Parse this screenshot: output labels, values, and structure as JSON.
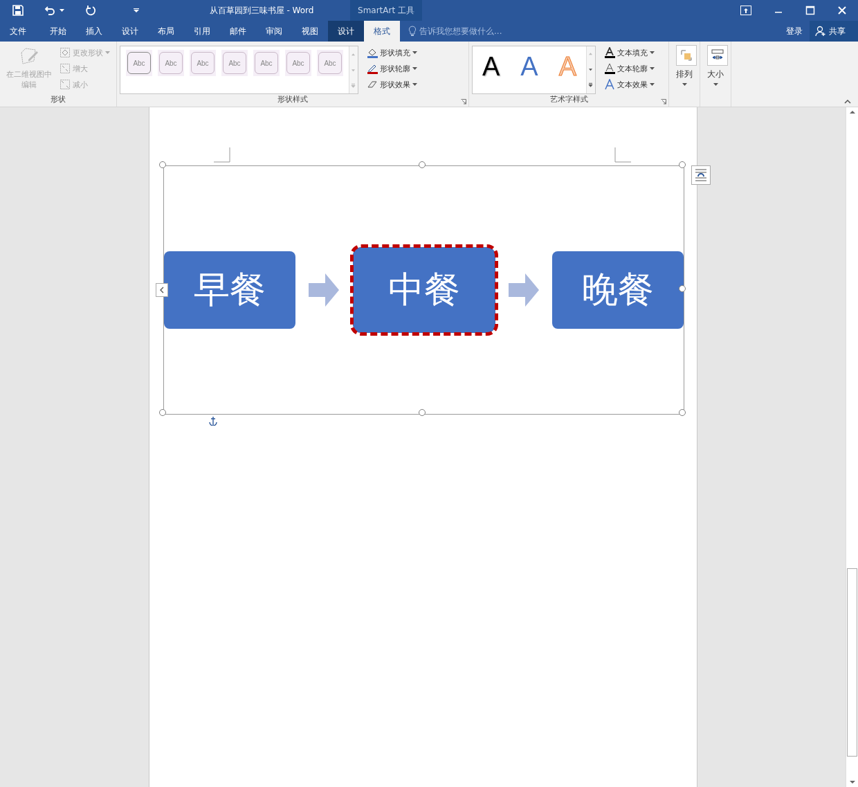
{
  "window": {
    "title": "从百草园到三味书屋 - Word",
    "context_group": "SmartArt 工具"
  },
  "tabs": [
    {
      "label": "文件",
      "selected": false,
      "contextual": false
    },
    {
      "label": "开始",
      "selected": false,
      "contextual": false
    },
    {
      "label": "插入",
      "selected": false,
      "contextual": false
    },
    {
      "label": "设计",
      "selected": false,
      "contextual": false
    },
    {
      "label": "布局",
      "selected": false,
      "contextual": false
    },
    {
      "label": "引用",
      "selected": false,
      "contextual": false
    },
    {
      "label": "邮件",
      "selected": false,
      "contextual": false
    },
    {
      "label": "审阅",
      "selected": false,
      "contextual": false
    },
    {
      "label": "视图",
      "selected": false,
      "contextual": false
    },
    {
      "label": "设计",
      "selected": false,
      "contextual": true
    },
    {
      "label": "格式",
      "selected": true,
      "contextual": true
    }
  ],
  "tell_me": {
    "placeholder": "告诉我您想要做什么..."
  },
  "account": {
    "sign_in": "登录",
    "share": "共享"
  },
  "shapes_group": {
    "label": "形状",
    "edit_2d": {
      "label": "在二维视图中编辑",
      "disabled": true
    },
    "items": [
      {
        "label": "更改形状",
        "disabled": true,
        "dropdown": true
      },
      {
        "label": "增大",
        "disabled": true,
        "dropdown": false
      },
      {
        "label": "减小",
        "disabled": true,
        "dropdown": false
      }
    ]
  },
  "shape_styles": {
    "label": "形状样式",
    "styles": [
      "Abc",
      "Abc",
      "Abc",
      "Abc",
      "Abc",
      "Abc",
      "Abc"
    ],
    "commands": [
      "形状填充",
      "形状轮廓",
      "形状效果"
    ]
  },
  "wordart_styles": {
    "label": "艺术字样式",
    "samples": [
      {
        "text": "A",
        "kind": "black"
      },
      {
        "text": "A",
        "kind": "blue"
      },
      {
        "text": "A",
        "kind": "orange"
      }
    ],
    "commands": [
      "文本填充",
      "文本轮廓",
      "文本效果"
    ]
  },
  "arrange": {
    "label": "排列"
  },
  "size": {
    "label": "大小"
  },
  "smartart": {
    "shapes": [
      {
        "text": "早餐",
        "selected": false
      },
      {
        "text": "中餐",
        "selected": true
      },
      {
        "text": "晚餐",
        "selected": false
      }
    ]
  }
}
